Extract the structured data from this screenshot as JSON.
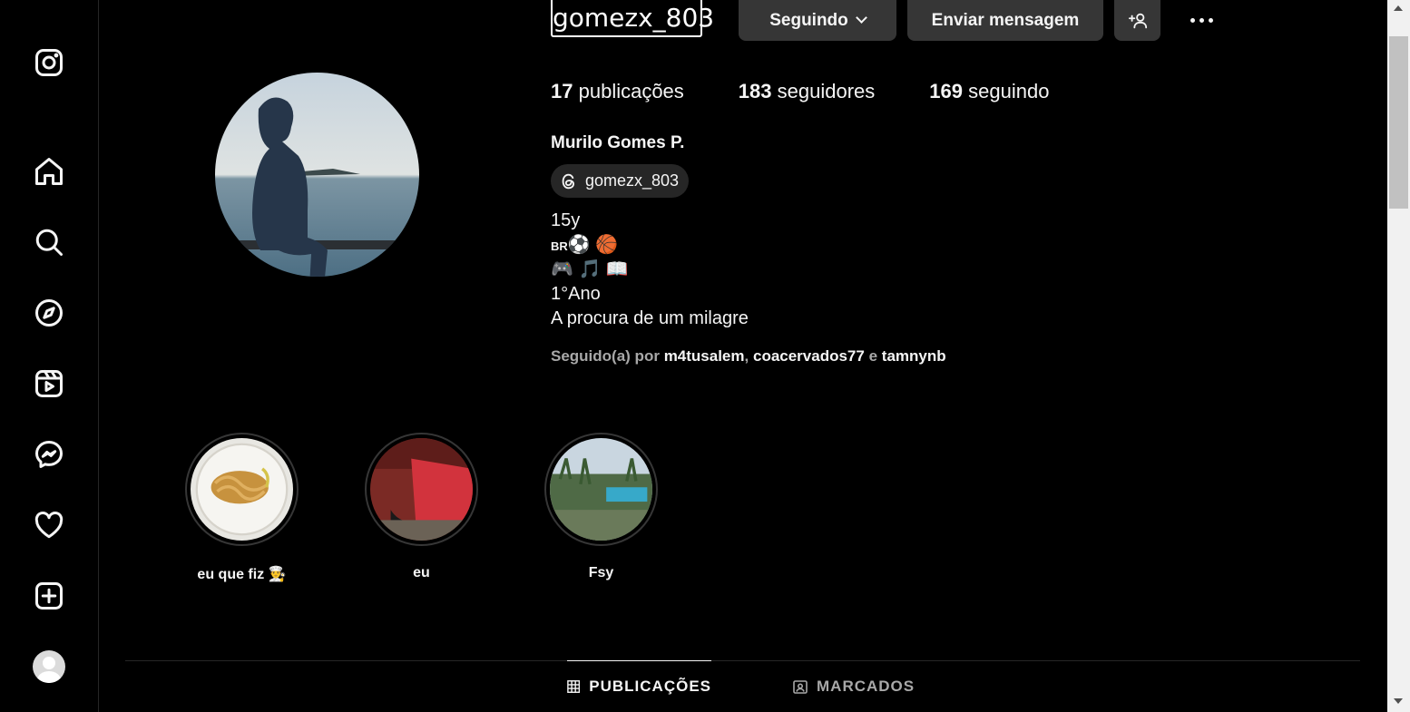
{
  "profile": {
    "username": "gomezx_803",
    "full_name": "Murilo Gomes P.",
    "threads_handle": "gomezx_803",
    "stats": {
      "posts_count": "17",
      "posts_label": "publicações",
      "followers_count": "183",
      "followers_label": "seguidores",
      "following_count": "169",
      "following_label": "seguindo"
    },
    "bio": {
      "line1": "15y",
      "line2_prefix": "BR",
      "line2_emojis": "⚽ 🏀",
      "line3": "🎮 🎵 📖",
      "line4": "1°Ano",
      "line5": "A procura de um milagre"
    },
    "followed_by": {
      "prefix": "Seguido(a) por",
      "user1": "m4tusalem",
      "sep1": ",",
      "user2": "coacervados77",
      "sep2": "e",
      "user3": "tamnynb"
    }
  },
  "actions": {
    "following_label": "Seguindo",
    "message_label": "Enviar mensagem"
  },
  "highlights": [
    {
      "label": "eu que fiz 👨‍🍳"
    },
    {
      "label": "eu"
    },
    {
      "label": "Fsy"
    }
  ],
  "tabs": {
    "posts": "PUBLICAÇÕES",
    "tagged": "MARCADOS"
  },
  "sidebar": {
    "icons": [
      "instagram-icon",
      "home-icon",
      "search-icon",
      "explore-icon",
      "reels-icon",
      "messenger-icon",
      "heart-icon",
      "create-icon",
      "profile-avatar"
    ]
  },
  "colors": {
    "background": "#000000",
    "button": "#363636",
    "muted_text": "#a8a8a8"
  }
}
